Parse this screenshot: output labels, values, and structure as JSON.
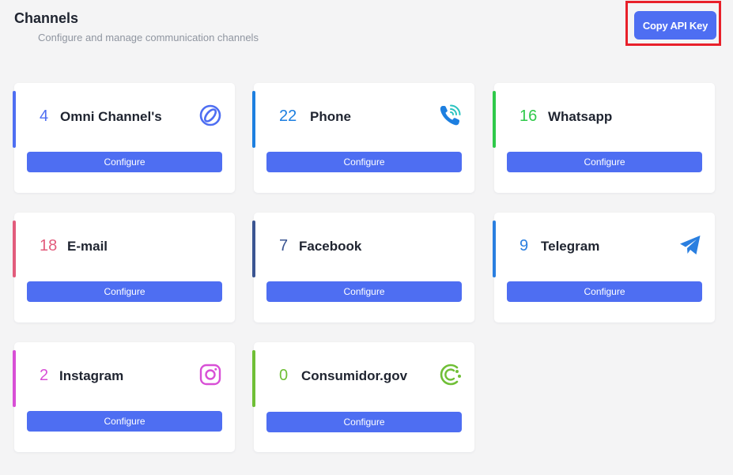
{
  "header": {
    "title": "Channels",
    "subtitle": "Configure and manage communication channels",
    "api_button_label": "Copy API Key"
  },
  "channels": [
    {
      "count": "4",
      "name": "Omni Channel's",
      "color": "#4e6ef2",
      "icon": "omni-channel-icon",
      "button_label": "Configure"
    },
    {
      "count": "22",
      "name": "Phone",
      "color": "#1d7fe0",
      "icon": "phone-icon",
      "button_label": "Configure"
    },
    {
      "count": "16",
      "name": "Whatsapp",
      "color": "#2fc94a",
      "icon": "",
      "button_label": "Configure"
    },
    {
      "count": "18",
      "name": "E-mail",
      "color": "#e25c7c",
      "icon": "",
      "button_label": "Configure"
    },
    {
      "count": "7",
      "name": "Facebook",
      "color": "#3b5592",
      "icon": "",
      "button_label": "Configure"
    },
    {
      "count": "9",
      "name": "Telegram",
      "color": "#2a7fe0",
      "icon": "telegram-icon",
      "button_label": "Configure"
    },
    {
      "count": "2",
      "name": "Instagram",
      "color": "#d84fd6",
      "icon": "instagram-icon",
      "button_label": "Configure"
    },
    {
      "count": "0",
      "name": "Consumidor.gov",
      "color": "#6fbf36",
      "icon": "consumidor-gov-icon",
      "button_label": "Configure"
    }
  ]
}
